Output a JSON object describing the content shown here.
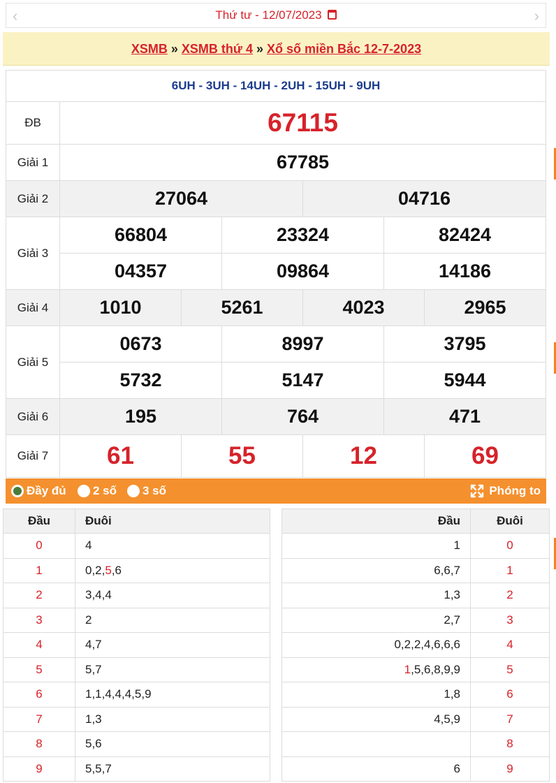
{
  "date_bar": {
    "prev_icon": "‹",
    "next_icon": "›",
    "date_text": "Thứ tư -  12/07/2023"
  },
  "breadcrumb": {
    "item1": "XSMB",
    "sep": " » ",
    "item2": "XSMB thứ 4",
    "item3": "Xổ số miền Bắc 12-7-2023"
  },
  "codes": "6UH - 3UH - 14UH - 2UH - 15UH - 9UH",
  "prizes": {
    "db": {
      "label": "ĐB",
      "numbers": [
        "67115"
      ]
    },
    "g1": {
      "label": "Giải 1",
      "numbers": [
        "67785"
      ]
    },
    "g2": {
      "label": "Giải 2",
      "numbers": [
        "27064",
        "04716"
      ]
    },
    "g3": {
      "label": "Giải 3",
      "numbers": [
        "66804",
        "23324",
        "82424",
        "04357",
        "09864",
        "14186"
      ]
    },
    "g4": {
      "label": "Giải 4",
      "numbers": [
        "1010",
        "5261",
        "4023",
        "2965"
      ]
    },
    "g5": {
      "label": "Giải 5",
      "numbers": [
        "0673",
        "8997",
        "3795",
        "5732",
        "5147",
        "5944"
      ]
    },
    "g6": {
      "label": "Giải 6",
      "numbers": [
        "195",
        "764",
        "471"
      ]
    },
    "g7": {
      "label": "Giải 7",
      "numbers": [
        "61",
        "55",
        "12",
        "69"
      ]
    }
  },
  "options": {
    "full": "Đầy đủ",
    "two": "2 số",
    "three": "3 số",
    "zoom": "Phóng to",
    "selected": "full"
  },
  "colors": {
    "accent_red": "#d6232a",
    "orange_bar": "#f5902e",
    "code_blue": "#1b3c8f",
    "crumb_bg": "#fbf2c4"
  },
  "loto_head": {
    "col_head": "Đầu",
    "col_tail": "Đuôi",
    "rows": [
      {
        "head": "0",
        "tail": [
          "4"
        ]
      },
      {
        "head": "1",
        "tail": [
          "0,2,",
          "5",
          ",6"
        ]
      },
      {
        "head": "2",
        "tail": [
          "3,4,4"
        ]
      },
      {
        "head": "3",
        "tail": [
          "2"
        ]
      },
      {
        "head": "4",
        "tail": [
          "4,7"
        ]
      },
      {
        "head": "5",
        "tail": [
          "5,7"
        ]
      },
      {
        "head": "6",
        "tail": [
          "1,1,4,4,4,5,9"
        ]
      },
      {
        "head": "7",
        "tail": [
          "1,3"
        ]
      },
      {
        "head": "8",
        "tail": [
          "5,6"
        ]
      },
      {
        "head": "9",
        "tail": [
          "5,5,7"
        ]
      }
    ]
  },
  "loto_tail": {
    "col_head": "Đầu",
    "col_tail": "Đuôi",
    "rows": [
      {
        "tail": "0",
        "head": [
          "1"
        ]
      },
      {
        "tail": "1",
        "head": [
          "6,6,7"
        ]
      },
      {
        "tail": "2",
        "head": [
          "1,3"
        ]
      },
      {
        "tail": "3",
        "head": [
          "2,7"
        ]
      },
      {
        "tail": "4",
        "head": [
          "0,2,2,4,6,6,6"
        ]
      },
      {
        "tail": "5",
        "head": [
          "1",
          ",5,6,8,9,9"
        ]
      },
      {
        "tail": "6",
        "head": [
          "1,8"
        ]
      },
      {
        "tail": "7",
        "head": [
          "4,5,9"
        ]
      },
      {
        "tail": "8",
        "head": [
          ""
        ]
      },
      {
        "tail": "9",
        "head": [
          "6"
        ]
      }
    ]
  }
}
